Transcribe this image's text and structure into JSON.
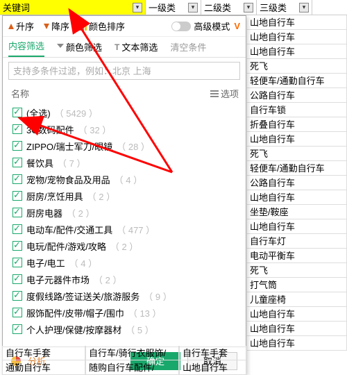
{
  "columns": {
    "keyword": "关键词",
    "level1": "一级类",
    "level2": "二级类",
    "level3": "三级类"
  },
  "sort": {
    "asc": "升序",
    "desc": "降序",
    "color": "颜色排序"
  },
  "advanced": {
    "label": "高级模式",
    "badge": "V"
  },
  "tabs": {
    "content": "内容筛选",
    "color": "颜色筛选",
    "text": "文本筛选",
    "clear": "清空条件"
  },
  "search": {
    "placeholder": "支持多条件过滤，例如：北京 上海"
  },
  "listHeader": {
    "name": "名称",
    "options": "选项"
  },
  "items": [
    {
      "label": "(全选)",
      "count": 5429,
      "checked": true
    },
    {
      "label": "3C数码配件",
      "count": 32,
      "checked": true
    },
    {
      "label": "ZIPPO/瑞士军刀/眼镜",
      "count": 28,
      "checked": true
    },
    {
      "label": "餐饮具",
      "count": 7,
      "checked": true
    },
    {
      "label": "宠物/宠物食品及用品",
      "count": 4,
      "checked": true
    },
    {
      "label": "厨房/烹饪用具",
      "count": 2,
      "checked": true
    },
    {
      "label": "厨房电器",
      "count": 2,
      "checked": true
    },
    {
      "label": "电动车/配件/交通工具",
      "count": 477,
      "checked": true
    },
    {
      "label": "电玩/配件/游戏/攻略",
      "count": 2,
      "checked": true
    },
    {
      "label": "电子/电工",
      "count": 4,
      "checked": true
    },
    {
      "label": "电子元器件市场",
      "count": 2,
      "checked": true
    },
    {
      "label": "度假线路/签证送关/旅游服务",
      "count": 9,
      "checked": true
    },
    {
      "label": "服饰配件/皮带/帽子/围巾",
      "count": 13,
      "checked": true
    },
    {
      "label": "个人护理/保健/按摩器材",
      "count": 5,
      "checked": true
    }
  ],
  "analyze": "分析",
  "buttons": {
    "ok": "确定",
    "cancel": "取消"
  },
  "rightColumn": [
    "山地自行车",
    "山地自行车",
    "山地自行车",
    "死飞",
    "轻便车/通勤自行车",
    "公路自行车",
    "自行车锁",
    "折叠自行车",
    "山地自行车",
    "死飞",
    "轻便车/通勤自行车",
    "公路自行车",
    "山地自行车",
    "坐垫/鞍座",
    "山地自行车",
    "自行车灯",
    "电动平衡车",
    "死飞",
    "打气筒",
    "儿童座椅",
    "山地自行车",
    "山地自行车",
    "山地自行车"
  ],
  "bottomPeek": {
    "row1": {
      "a": "自行车手套",
      "b": "自行车/骑行衣服饰/",
      "c": "自行车手套"
    },
    "row2": {
      "a": "通勤自行车",
      "b": "随购自行车配件/",
      "c": "山地自行车"
    }
  }
}
